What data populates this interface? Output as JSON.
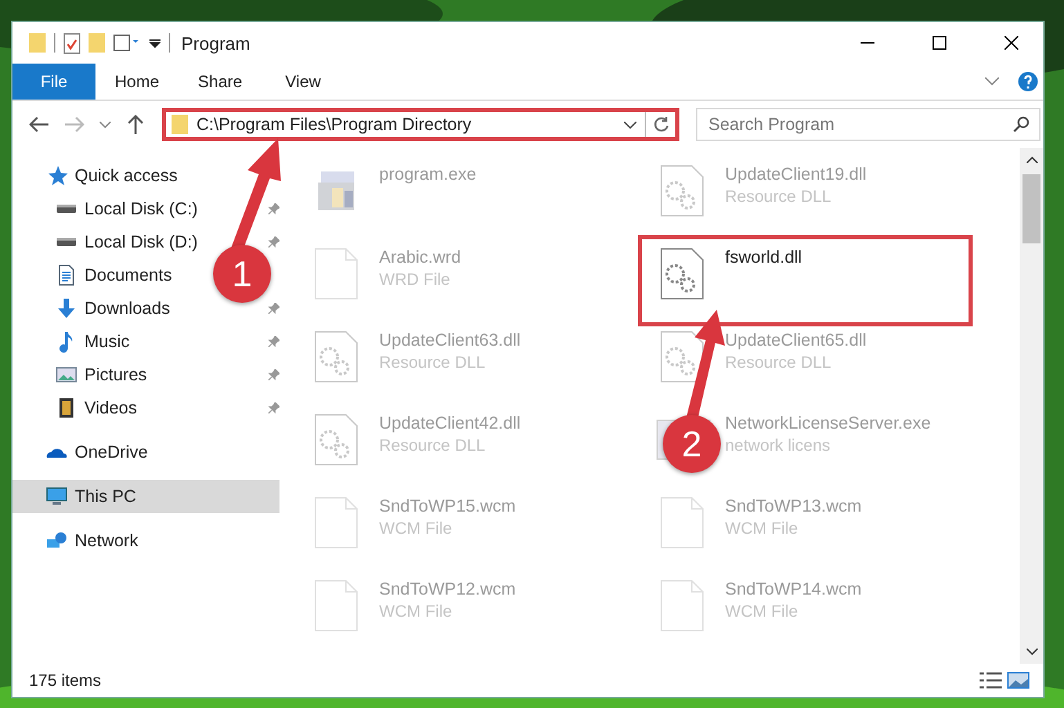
{
  "window": {
    "title": "Program"
  },
  "ribbon": {
    "tabs": [
      {
        "label": "File",
        "selected": true
      },
      {
        "label": "Home",
        "selected": false
      },
      {
        "label": "Share",
        "selected": false
      },
      {
        "label": "View",
        "selected": false
      }
    ]
  },
  "address_bar": {
    "path": "C:\\Program Files\\Program Directory",
    "highlighted": true
  },
  "search": {
    "placeholder": "Search Program"
  },
  "sidebar": {
    "items": [
      {
        "label": "Quick access",
        "kind": "star",
        "selected": false,
        "children": [
          {
            "label": "Local Disk (C:)",
            "kind": "disk",
            "pinned": true
          },
          {
            "label": "Local Disk (D:)",
            "kind": "disk",
            "pinned": true
          },
          {
            "label": "Documents",
            "kind": "documents"
          },
          {
            "label": "Downloads",
            "kind": "downloads",
            "pinned": true
          },
          {
            "label": "Music",
            "kind": "music",
            "pinned": true
          },
          {
            "label": "Pictures",
            "kind": "pictures",
            "pinned": true
          },
          {
            "label": "Videos",
            "kind": "videos",
            "pinned": true
          }
        ]
      },
      {
        "label": "OneDrive",
        "kind": "cloud",
        "selected": false
      },
      {
        "label": "This PC",
        "kind": "pc",
        "selected": true
      },
      {
        "label": "Network",
        "kind": "network",
        "selected": false
      }
    ]
  },
  "files": [
    {
      "name": "program.exe",
      "kind": "exe",
      "highlighted": false
    },
    {
      "name": "UpdateClient19.dll",
      "type": "Resource DLL",
      "kind": "dll",
      "highlighted": false
    },
    {
      "name": "Arabic.wrd",
      "type": "WRD File",
      "kind": "blank",
      "highlighted": false
    },
    {
      "name": "fsworld.dll",
      "kind": "dll",
      "highlighted": true
    },
    {
      "name": "UpdateClient63.dll",
      "type": "Resource DLL",
      "kind": "dll",
      "highlighted": false
    },
    {
      "name": "UpdateClient65.dll",
      "type": "Resource DLL",
      "kind": "dll",
      "highlighted": false
    },
    {
      "name": "UpdateClient42.dll",
      "type": "Resource DLL",
      "kind": "dll",
      "highlighted": false
    },
    {
      "name": "NetworkLicenseServer.exe",
      "type": "network licens",
      "kind": "app",
      "highlighted": false
    },
    {
      "name": "SndToWP15.wcm",
      "type": "WCM File",
      "kind": "blank",
      "highlighted": false
    },
    {
      "name": "SndToWP13.wcm",
      "type": "WCM File",
      "kind": "blank",
      "highlighted": false
    },
    {
      "name": "SndToWP12.wcm",
      "type": "WCM File",
      "kind": "blank",
      "highlighted": false
    },
    {
      "name": "SndToWP14.wcm",
      "type": "WCM File",
      "kind": "blank",
      "highlighted": false
    }
  ],
  "callouts": [
    {
      "label": "1"
    },
    {
      "label": "2"
    }
  ],
  "status_bar": {
    "count": "175 items"
  }
}
